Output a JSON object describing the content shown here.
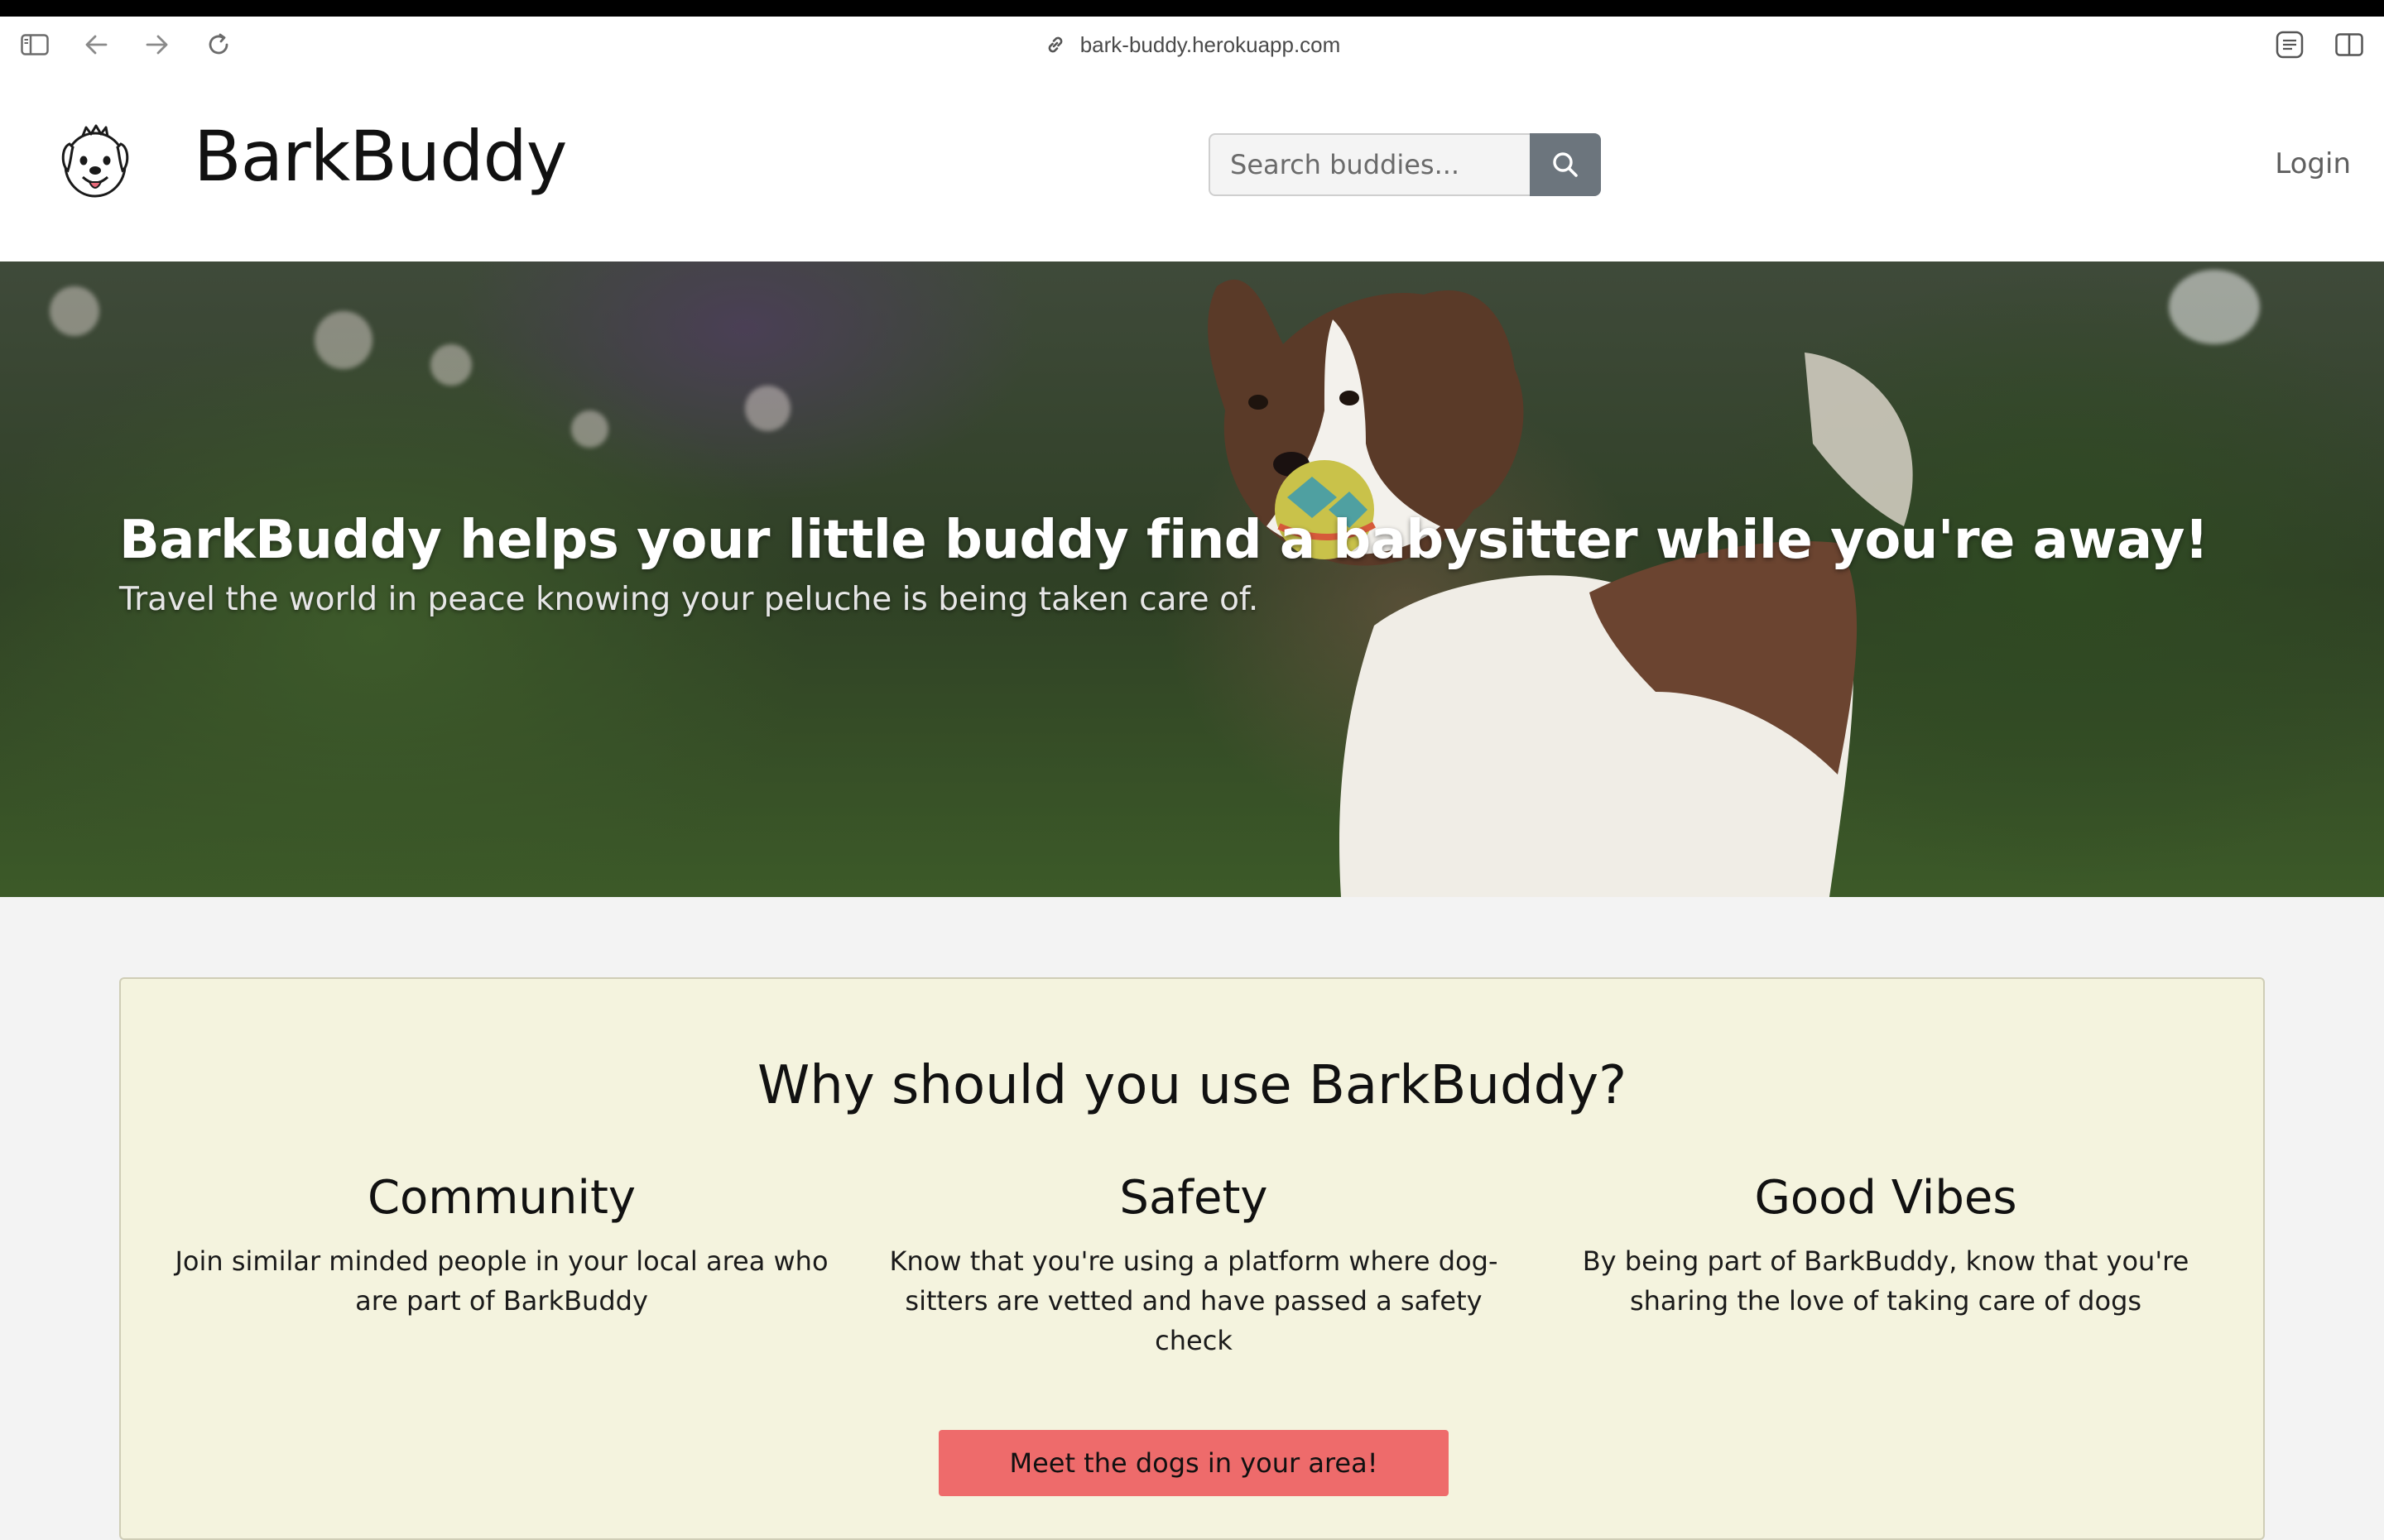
{
  "browser": {
    "url": "bark-buddy.herokuapp.com",
    "icons": [
      "sidebar-icon",
      "back-icon",
      "forward-icon",
      "reload-icon",
      "link-icon",
      "reader-icon",
      "split-view-icon"
    ]
  },
  "header": {
    "brand": "BarkBuddy",
    "search": {
      "placeholder": "Search buddies...",
      "value": ""
    },
    "login_label": "Login"
  },
  "hero": {
    "title": "BarkBuddy helps your little buddy find a babysitter while you're away!",
    "subtitle": "Travel the world in peace knowing your peluche is being taken care of."
  },
  "why": {
    "title": "Why should you use BarkBuddy?",
    "features": [
      {
        "title": "Community",
        "text": "Join similar minded people in your local area who are part of BarkBuddy"
      },
      {
        "title": "Safety",
        "text": "Know that you're using a platform where dog-sitters are vetted and have passed a safety check"
      },
      {
        "title": "Good Vibes",
        "text": "By being part of BarkBuddy, know that you're sharing the love of taking care of dogs"
      }
    ],
    "cta_label": "Meet the dogs in your area!"
  },
  "colors": {
    "search_button": "#6c757d",
    "card_background": "#f4f3de",
    "cta_background": "#ee6b6b",
    "page_background": "#f3f3f3"
  }
}
